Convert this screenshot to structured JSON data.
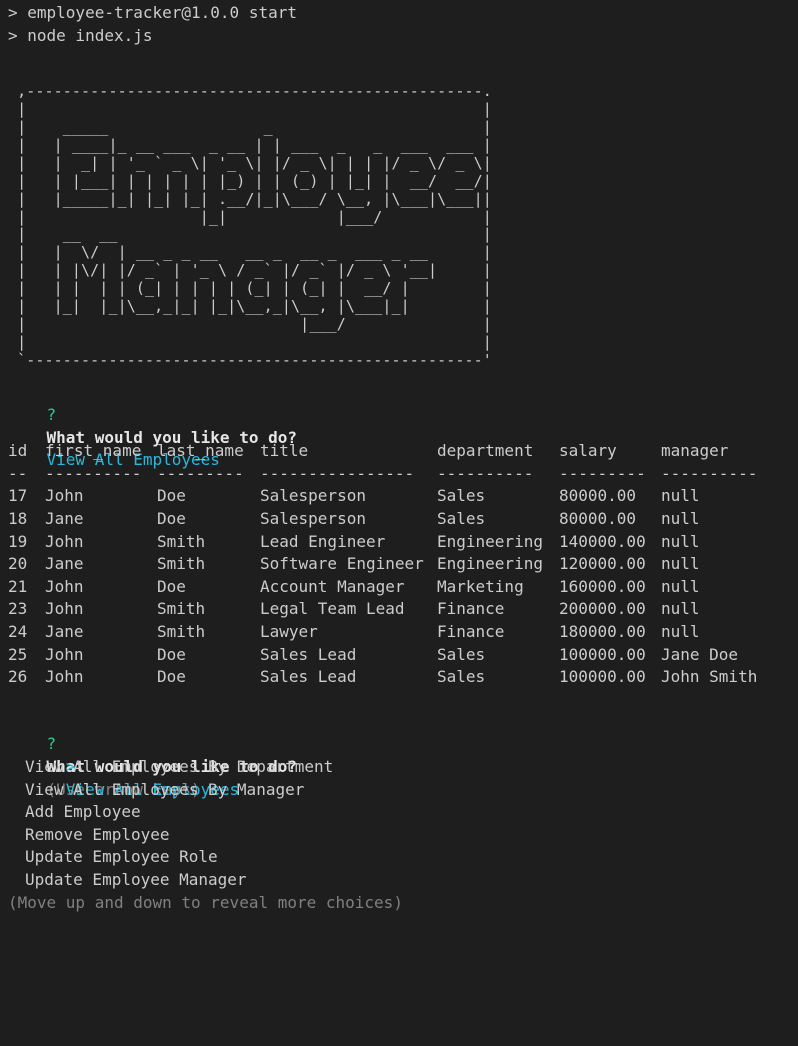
{
  "terminal": {
    "command_lines": [
      "> employee-tracker@1.0.0 start",
      "> node index.js"
    ],
    "banner_art": " ,--------------------------------------------------.\n |                                                  |\n |    _____                 _                       |\n |   | ____|_ __ ___  _ __ | | ___  _   _  ___  ___ |\n |   |  _| | '_ ` _ \\| '_ \\| |/ _ \\| | | |/ _ \\/ _ \\|\n |   | |___| | | | | | |_) | | (_) | |_| |  __/  __/|\n |   |_____|_| |_| |_| .__/|_|\\___/ \\__, |\\___|\\___||\n |                   |_|            |___/           |\n |    __  __                                        |\n |   |  \\/  | __ _ _ __   __ _  __ _  ___ _ __      |\n |   | |\\/| |/ _` | '_ \\ / _` |/ _` |/ _ \\ '__|     |\n |   | |  | | (_| | | | | (_| | (_| |  __/ |        |\n |   |_|  |_|\\__,_|_| |_|\\__,_|\\__, |\\___|_|        |\n |                              |___/               |\n |                                                  |\n `--------------------------------------------------'",
    "first_prompt": {
      "mark": "?",
      "question": "What would you like to do?",
      "answer": "View All Employees"
    },
    "table": {
      "headers": [
        "id",
        "first_name",
        "last_name",
        "title",
        "department",
        "salary",
        "manager"
      ],
      "separators": [
        "--",
        "----------",
        "---------",
        "----------------",
        "----------",
        "---------",
        "----------"
      ],
      "rows": [
        [
          "17",
          "John",
          "Doe",
          "Salesperson",
          "Sales",
          "80000.00",
          "null"
        ],
        [
          "18",
          "Jane",
          "Doe",
          "Salesperson",
          "Sales",
          "80000.00",
          "null"
        ],
        [
          "19",
          "John",
          "Smith",
          "Lead Engineer",
          "Engineering",
          "140000.00",
          "null"
        ],
        [
          "20",
          "Jane",
          "Smith",
          "Software Engineer",
          "Engineering",
          "120000.00",
          "null"
        ],
        [
          "21",
          "John",
          "Doe",
          "Account Manager",
          "Marketing",
          "160000.00",
          "null"
        ],
        [
          "23",
          "John",
          "Smith",
          "Legal Team Lead",
          "Finance",
          "200000.00",
          "null"
        ],
        [
          "24",
          "Jane",
          "Smith",
          "Lawyer",
          "Finance",
          "180000.00",
          "null"
        ],
        [
          "25",
          "John",
          "Doe",
          "Sales Lead",
          "Sales",
          "100000.00",
          "Jane Doe"
        ],
        [
          "26",
          "John",
          "Doe",
          "Sales Lead",
          "Sales",
          "100000.00",
          "John Smith"
        ]
      ]
    },
    "second_prompt": {
      "mark": "?",
      "question": "What would you like to do?",
      "hint": "(Use arrow keys)",
      "pointer": ">",
      "choices": [
        "View All Employees",
        "View All Employees By Department",
        "View All Employees By Manager",
        "Add Employee",
        "Remove Employee",
        "Update Employee Role",
        "Update Employee Manager"
      ],
      "selected_index": 0,
      "footer_hint": "(Move up and down to reveal more choices)"
    },
    "colors": {
      "background": "#1e1e1e",
      "text": "#cccccc",
      "question_mark": "#23d18b",
      "highlight": "#29b8db",
      "hint": "#808080"
    }
  }
}
